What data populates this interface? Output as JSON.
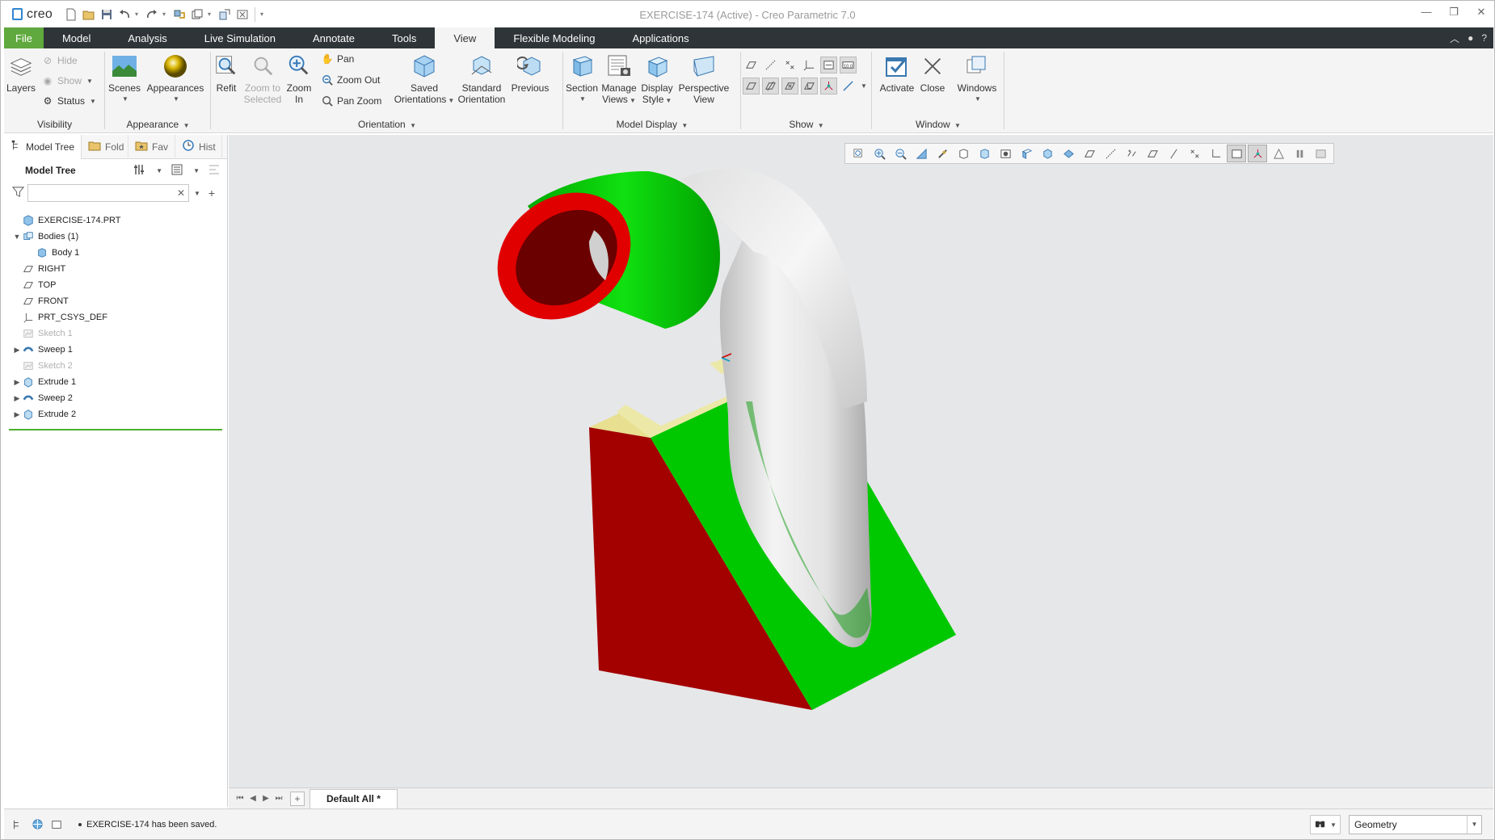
{
  "app": {
    "logo_text": "creo",
    "window_title": "EXERCISE-174 (Active) - Creo Parametric 7.0"
  },
  "ribbon_tabs": [
    "File",
    "Model",
    "Analysis",
    "Live Simulation",
    "Annotate",
    "Tools",
    "View",
    "Flexible Modeling",
    "Applications"
  ],
  "active_tab": "View",
  "ribbon": {
    "visibility": {
      "label": "Visibility",
      "layers": "Layers",
      "hide": "Hide",
      "show": "Show",
      "status": "Status"
    },
    "appearance": {
      "label": "Appearance",
      "scenes": "Scenes",
      "appearances": "Appearances"
    },
    "orientation": {
      "label": "Orientation",
      "refit": "Refit",
      "zoom_to_selected_1": "Zoom to",
      "zoom_to_selected_2": "Selected",
      "zoom_in_1": "Zoom",
      "zoom_in_2": "In",
      "pan": "Pan",
      "zoom_out": "Zoom Out",
      "pan_zoom": "Pan Zoom",
      "saved_1": "Saved",
      "saved_2": "Orientations",
      "standard_1": "Standard",
      "standard_2": "Orientation",
      "previous": "Previous"
    },
    "model_display": {
      "label": "Model Display",
      "section": "Section",
      "manage_1": "Manage",
      "manage_2": "Views",
      "display_1": "Display",
      "display_2": "Style",
      "perspective_1": "Perspective",
      "perspective_2": "View"
    },
    "show": {
      "label": "Show"
    },
    "window": {
      "label": "Window",
      "activate": "Activate",
      "close": "Close",
      "windows": "Windows"
    }
  },
  "panel_tabs": [
    "Model Tree",
    "Fold",
    "Fav",
    "Hist"
  ],
  "model_tree": {
    "title": "Model Tree",
    "filter_placeholder": "",
    "items": [
      {
        "label": "EXERCISE-174.PRT",
        "indent": 0,
        "icon": "part-icon",
        "expander": "",
        "dim": false
      },
      {
        "label": "Bodies (1)",
        "indent": 0,
        "icon": "bodies-icon",
        "expander": "▼",
        "dim": false
      },
      {
        "label": "Body 1",
        "indent": 1,
        "icon": "body-icon",
        "expander": "",
        "dim": false
      },
      {
        "label": "RIGHT",
        "indent": 0,
        "icon": "datum-plane-icon",
        "expander": "",
        "dim": false
      },
      {
        "label": "TOP",
        "indent": 0,
        "icon": "datum-plane-icon",
        "expander": "",
        "dim": false
      },
      {
        "label": "FRONT",
        "indent": 0,
        "icon": "datum-plane-icon",
        "expander": "",
        "dim": false
      },
      {
        "label": "PRT_CSYS_DEF",
        "indent": 0,
        "icon": "csys-icon",
        "expander": "",
        "dim": false
      },
      {
        "label": "Sketch 1",
        "indent": 0,
        "icon": "sketch-icon",
        "expander": "",
        "dim": true
      },
      {
        "label": "Sweep 1",
        "indent": 0,
        "icon": "sweep-icon",
        "expander": "▶",
        "dim": false
      },
      {
        "label": "Sketch 2",
        "indent": 0,
        "icon": "sketch-icon",
        "expander": "",
        "dim": true
      },
      {
        "label": "Extrude 1",
        "indent": 0,
        "icon": "extrude-icon",
        "expander": "▶",
        "dim": false
      },
      {
        "label": "Sweep 2",
        "indent": 0,
        "icon": "sweep-icon",
        "expander": "▶",
        "dim": false
      },
      {
        "label": "Extrude 2",
        "indent": 0,
        "icon": "extrude-icon",
        "expander": "▶",
        "dim": false
      }
    ]
  },
  "view_tabs": {
    "active": "Default All *"
  },
  "status": {
    "message": "EXERCISE-174 has been saved.",
    "filter_value": "Geometry"
  },
  "colors": {
    "file_tab": "#5fa93e",
    "tab_bar": "#2e3438",
    "model_red": "#a40000",
    "model_green": "#00c000",
    "model_white": "#e8e8e8"
  }
}
